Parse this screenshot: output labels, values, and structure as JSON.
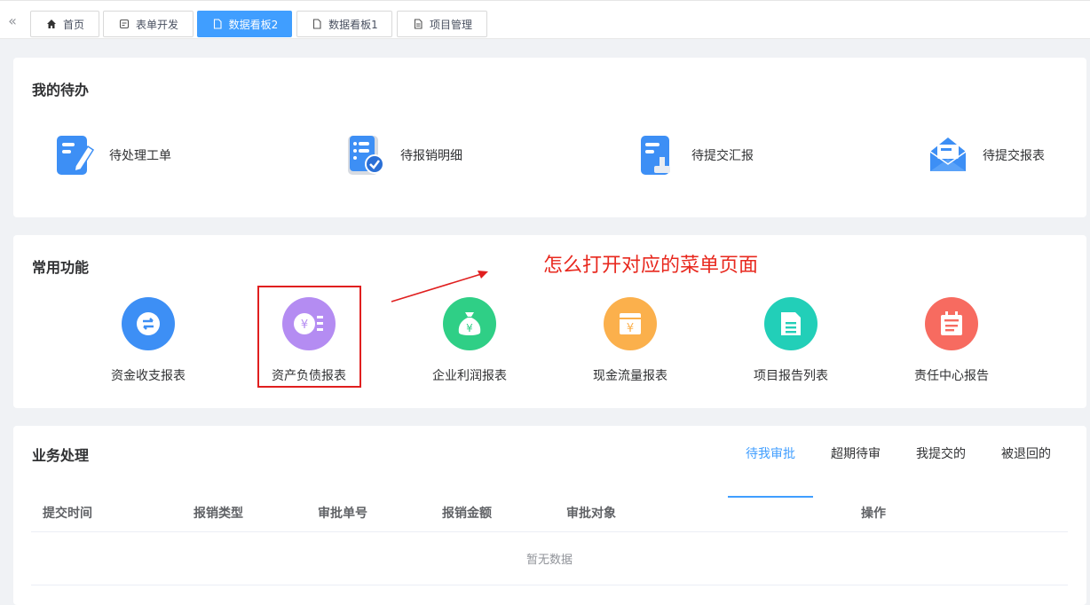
{
  "tabs": [
    {
      "label": "首页",
      "icon": "home-icon",
      "active": false
    },
    {
      "label": "表单开发",
      "icon": "form-icon",
      "active": false
    },
    {
      "label": "数据看板2",
      "icon": "file-icon",
      "active": true
    },
    {
      "label": "数据看板1",
      "icon": "file-icon",
      "active": false
    },
    {
      "label": "项目管理",
      "icon": "document-icon",
      "active": false
    }
  ],
  "todo": {
    "title": "我的待办",
    "items": [
      {
        "label": "待处理工单",
        "icon": "edit-document-icon"
      },
      {
        "label": "待报销明细",
        "icon": "checklist-icon"
      },
      {
        "label": "待提交汇报",
        "icon": "stamp-document-icon"
      },
      {
        "label": "待提交报表",
        "icon": "mail-icon"
      }
    ]
  },
  "common": {
    "title": "常用功能",
    "items": [
      {
        "label": "资金收支报表",
        "icon": "exchange-icon",
        "color": "#3d8ff5"
      },
      {
        "label": "资产负债报表",
        "icon": "yen-coin-icon",
        "color": "#b48cf2"
      },
      {
        "label": "企业利润报表",
        "icon": "money-bag-icon",
        "color": "#2fcf86"
      },
      {
        "label": "现金流量报表",
        "icon": "yen-box-icon",
        "color": "#fbb04c"
      },
      {
        "label": "项目报告列表",
        "icon": "report-icon",
        "color": "#22cfb8"
      },
      {
        "label": "责任中心报告",
        "icon": "calendar-icon",
        "color": "#f76b60"
      }
    ],
    "annotation": "怎么打开对应的菜单页面"
  },
  "business": {
    "title": "业务处理",
    "tabs": [
      "待我审批",
      "超期待审",
      "我提交的",
      "被退回的"
    ],
    "active_tab": "待我审批",
    "columns": [
      "提交时间",
      "报销类型",
      "审批单号",
      "报销金额",
      "审批对象",
      "操作"
    ],
    "empty_text": "暂无数据"
  },
  "colors": {
    "accent": "#409eff",
    "annotation": "#e8281e"
  }
}
